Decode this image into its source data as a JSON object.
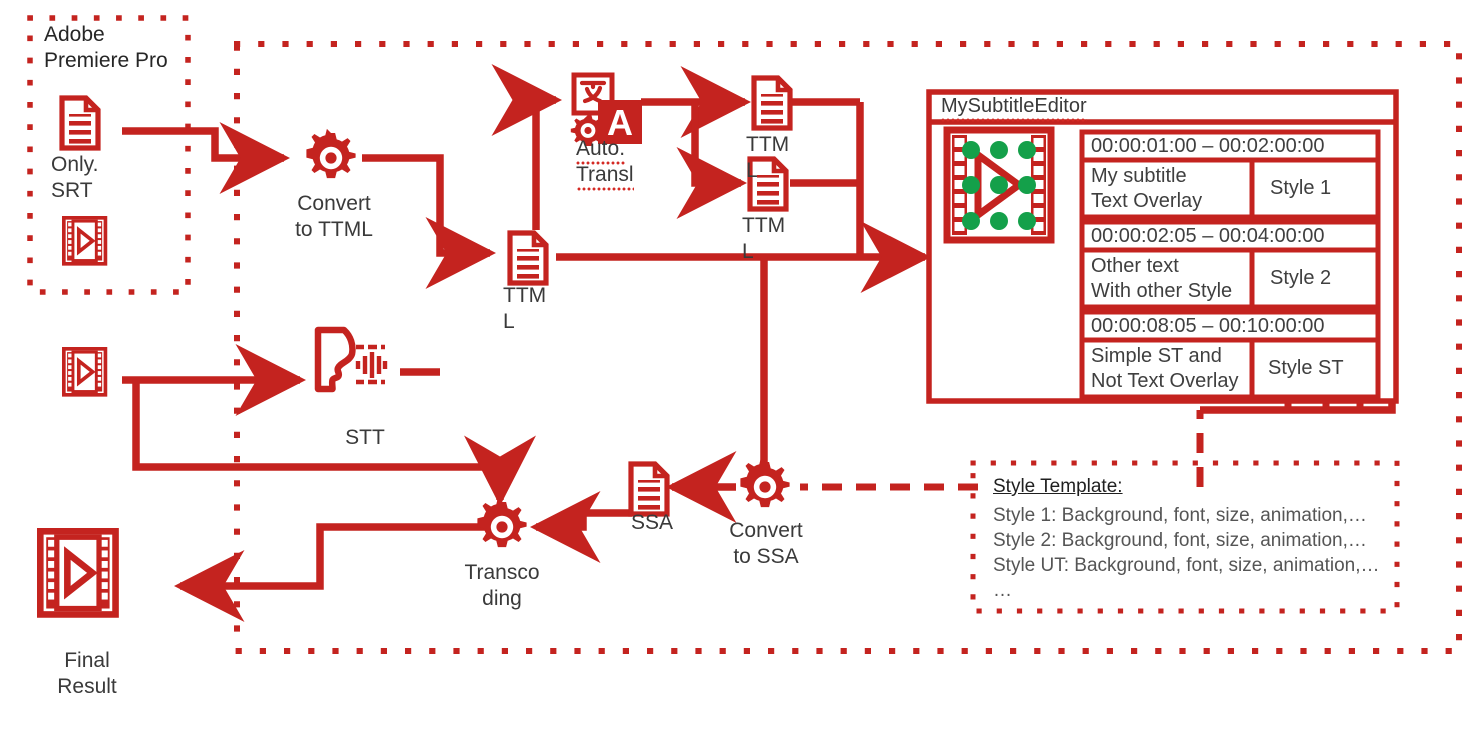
{
  "colors": {
    "primary": "#c4231f",
    "accent_red": "#cf2a23",
    "text": "#3a3a3a",
    "green": "#14a04a",
    "white": "#ffffff"
  },
  "source_group": {
    "title_line1": "Adobe",
    "title_line2": "Premiere Pro",
    "srt_doc_label": "Only.\nSRT",
    "video_icon_name": "video-clip-icon"
  },
  "nodes": {
    "convert_to_ttml": "Convert\nto TTML",
    "ttml_main": "TTM\nL",
    "auto_translate": "Auto.\nTransl",
    "ttml_lang1": "TTM\nL",
    "ttml_lang2": "TTM\nL",
    "stt": "STT",
    "convert_to_ssa": "Convert\nto SSA",
    "ssa": "SSA",
    "transcoding": "Transco\nding",
    "final_result": "Final\nResult"
  },
  "editor": {
    "title": "MySubtitleEditor",
    "preview_icon_name": "video-preview-with-handles",
    "rows": [
      {
        "timecode": "00:00:01:00 – 00:02:00:00",
        "text": "My subtitle\nText Overlay",
        "style": "Style 1"
      },
      {
        "timecode": "00:00:02:05 – 00:04:00:00",
        "text": "Other text\nWith other Style",
        "style": "Style 2"
      },
      {
        "timecode": "00:00:08:05 – 00:10:00:00",
        "text": "Simple ST and\nNot Text Overlay",
        "style": "Style ST"
      }
    ]
  },
  "style_template": {
    "heading": "Style Template:",
    "lines": [
      "Style 1: Background, font, size, animation,…",
      "Style 2: Background, font, size, animation,…",
      "Style UT: Background, font, size, animation,…",
      "…"
    ]
  }
}
